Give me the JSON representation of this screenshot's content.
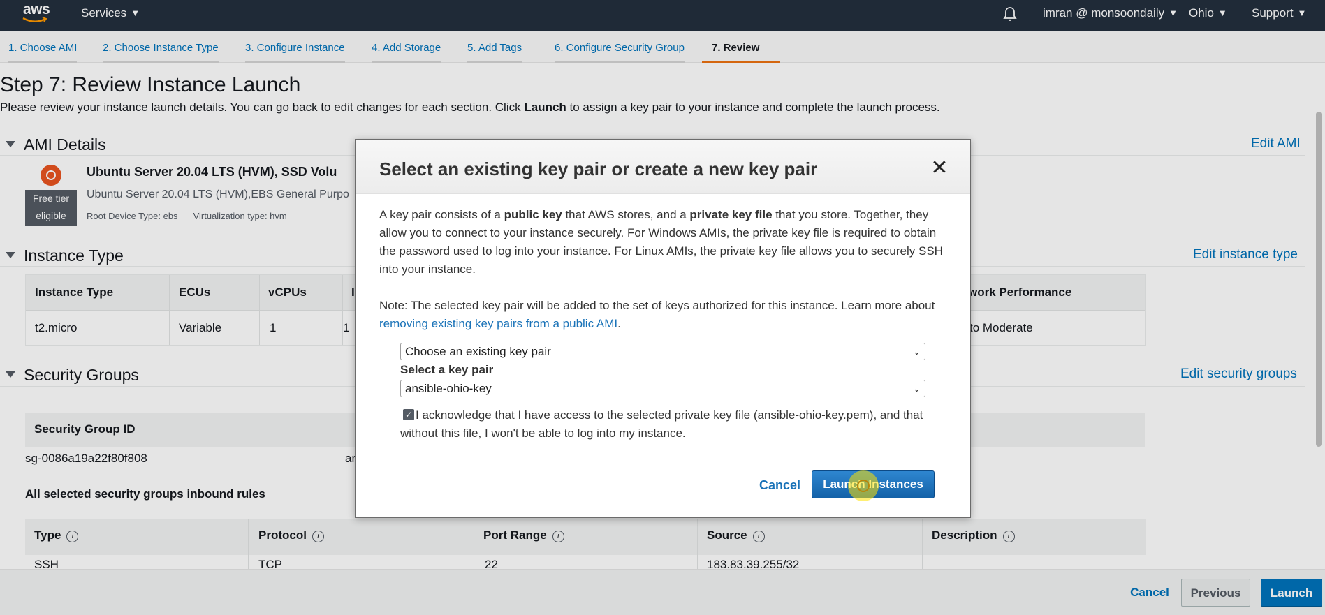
{
  "topbar": {
    "logo_text": "aws",
    "services": "Services",
    "account": "imran @ monsoondaily",
    "region": "Ohio",
    "support": "Support",
    "bell_icon": "bell-icon"
  },
  "tabs": [
    {
      "label": "1. Choose AMI"
    },
    {
      "label": "2. Choose Instance Type"
    },
    {
      "label": "3. Configure Instance"
    },
    {
      "label": "4. Add Storage"
    },
    {
      "label": "5. Add Tags"
    },
    {
      "label": "6. Configure Security Group"
    },
    {
      "label": "7. Review"
    }
  ],
  "page": {
    "title": "Step 7: Review Instance Launch",
    "subtitle_pre": "Please review your instance launch details. You can go back to edit changes for each section. Click ",
    "subtitle_bold": "Launch",
    "subtitle_post": " to assign a key pair to your instance and complete the launch process."
  },
  "ami": {
    "heading": "AMI Details",
    "edit": "Edit AMI",
    "name": "Ubuntu Server 20.04 LTS (HVM), SSD Volu",
    "desc": "Ubuntu Server 20.04 LTS (HVM),EBS General Purpo",
    "badge_line1": "Free tier",
    "badge_line2": "eligible",
    "root_device": "Root Device Type: ebs",
    "virt_type": "Virtualization type: hvm"
  },
  "instance": {
    "heading": "Instance Type",
    "edit": "Edit instance type",
    "headers": [
      "Instance Type",
      "ECUs",
      "vCPUs",
      "I",
      "work Performance"
    ],
    "row": [
      "t2.micro",
      "Variable",
      "1",
      "1",
      "to Moderate"
    ]
  },
  "security": {
    "heading": "Security Groups",
    "edit": "Edit security groups",
    "col_header": "Security Group ID",
    "group_id": "sg-0086a19a22f80f808",
    "group_name_partial": "ar",
    "inbound_title": "All selected security groups inbound rules",
    "rules_headers": [
      "Type",
      "Protocol",
      "Port Range",
      "Source",
      "Description"
    ],
    "rule_row": [
      "SSH",
      "TCP",
      "22",
      "183.83.39.255/32",
      ""
    ]
  },
  "footer": {
    "cancel": "Cancel",
    "previous": "Previous",
    "launch": "Launch"
  },
  "modal": {
    "title": "Select an existing key pair or create a new key pair",
    "close_glyph": "✕",
    "p1_a": "A key pair consists of a ",
    "p1_b": "public key",
    "p1_c": " that AWS stores, and a ",
    "p1_d": "private key file",
    "p1_e": " that you store. Together, they allow you to connect to your instance securely. For Windows AMIs, the private key file is required to obtain the password used to log into your instance. For Linux AMIs, the private key file allows you to securely SSH into your instance.",
    "note_a": "Note: The selected key pair will be added to the set of keys authorized for this instance. Learn more about ",
    "note_link": "removing existing key pairs from a public AMI",
    "note_b": ".",
    "mode_select": "Choose an existing key pair",
    "select_label": "Select a key pair",
    "keypair_select": "ansible-ohio-key",
    "ack_checked": true,
    "ack_text": "I acknowledge that I have access to the selected private key file (ansible-ohio-key.pem), and that without this file, I won't be able to log into my instance.",
    "cancel": "Cancel",
    "launch": "Launch Instances"
  },
  "colors": {
    "nav_bg": "#232f3e",
    "link": "#0073bb",
    "accent_tab": "#ec7211",
    "primary_btn": "#1462a8"
  }
}
